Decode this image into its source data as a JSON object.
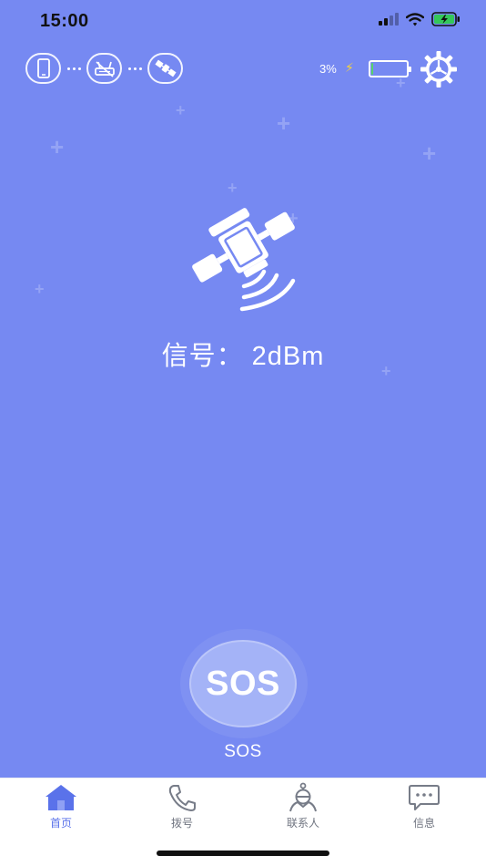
{
  "status_bar": {
    "time": "15:00"
  },
  "device": {
    "battery_text": "3%",
    "battery_level": 0.03
  },
  "signal": {
    "text": "信号：  2dBm"
  },
  "sos": {
    "button_text": "SOS",
    "label": "SOS"
  },
  "tabs": [
    {
      "label": "首页",
      "icon": "home-icon",
      "active": true
    },
    {
      "label": "拨号",
      "icon": "phone-icon",
      "active": false
    },
    {
      "label": "联系人",
      "icon": "contact-icon",
      "active": false
    },
    {
      "label": "信息",
      "icon": "message-icon",
      "active": false
    }
  ],
  "colors": {
    "background": "#7689f2",
    "accent": "#5a72ea",
    "battery_fill": "#59d36a",
    "charging": "#f7d43a"
  }
}
